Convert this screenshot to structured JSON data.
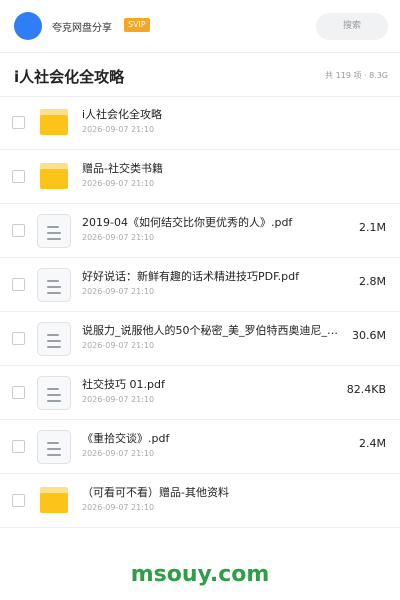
{
  "header": {
    "username": "夸克网盘分享",
    "vip_badge": "SVIP",
    "search_label": "搜索"
  },
  "folder": {
    "title": "i人社会化全攻略",
    "meta": "共 119 项 · 8.3G"
  },
  "files": [
    {
      "name": "i人社会化全攻略",
      "date": "2026-09-07 21:10",
      "size": "",
      "type": "folder"
    },
    {
      "name": "赠品-社交类书籍",
      "date": "2026-09-07 21:10",
      "size": "",
      "type": "folder"
    },
    {
      "name": "2019-04《如何结交比你更优秀的人》.pdf",
      "date": "2026-09-07 21:10",
      "size": "2.1M",
      "type": "doc"
    },
    {
      "name": "好好说话：新鲜有趣的话术精进技巧PDF.pdf",
      "date": "2026-09-07 21:10",
      "size": "2.8M",
      "type": "doc"
    },
    {
      "name": "说服力_说服他人的50个秘密_美_罗伯特西奥迪尼_…",
      "date": "2026-09-07 21:10",
      "size": "30.6M",
      "type": "doc"
    },
    {
      "name": "社交技巧 01.pdf",
      "date": "2026-09-07 21:10",
      "size": "82.4KB",
      "type": "doc"
    },
    {
      "name": "《重拾交谈》.pdf",
      "date": "2026-09-07 21:10",
      "size": "2.4M",
      "type": "doc"
    },
    {
      "name": "（可看可不看）赠品-其他资料",
      "date": "2026-09-07 21:10",
      "size": "",
      "type": "folder"
    }
  ],
  "watermark": "msouy.com",
  "colors": {
    "accent": "#2f7ef5",
    "vip": "#f5a623",
    "folder": "#fcc419",
    "watermark": "#2e9e47"
  },
  "icons": {
    "folder": "folder-icon",
    "document": "pdf-document-icon"
  }
}
